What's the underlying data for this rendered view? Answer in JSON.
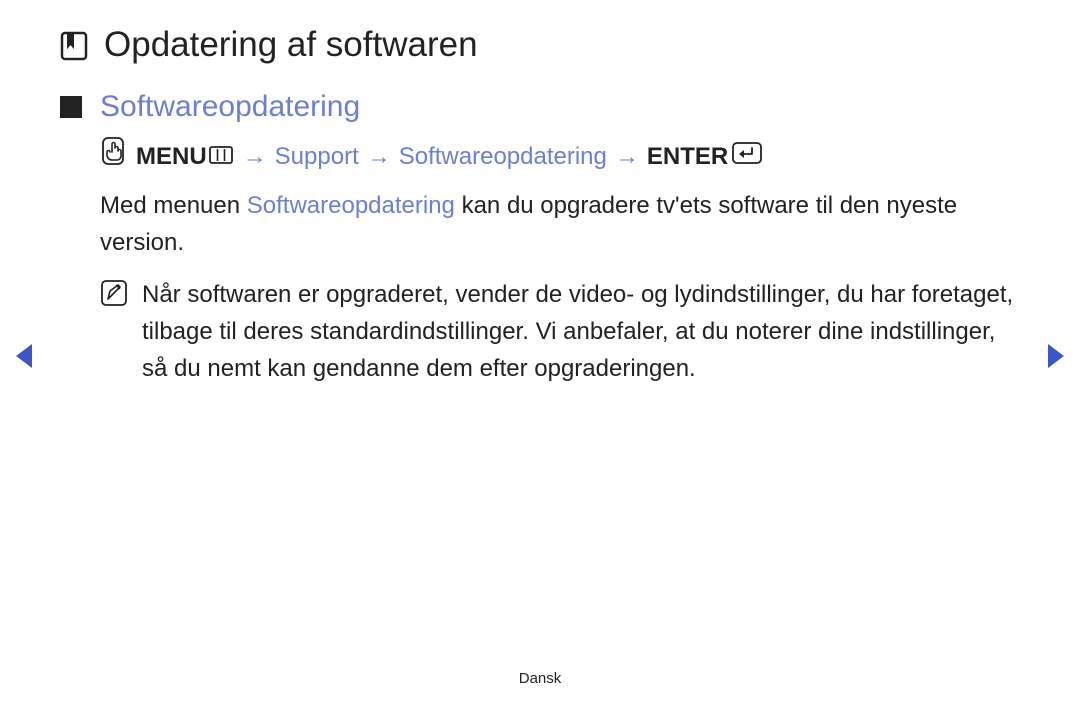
{
  "title": "Opdatering af softwaren",
  "section": "Softwareopdatering",
  "breadcrumb": {
    "menu_label": "MENU",
    "sep": "→",
    "step1": "Support",
    "step2": "Softwareopdatering",
    "enter_label": "ENTER"
  },
  "body": {
    "pre": "Med menuen ",
    "highlight": "Softwareopdatering",
    "post": " kan du opgradere tv'ets software til den nyeste version."
  },
  "note_text": "Når softwaren er opgraderet, vender de video- og lydindstillinger, du har foretaget, tilbage til deres standardindstillinger. Vi anbefaler, at du noterer dine indstillinger, så du nemt kan gendanne dem efter opgraderingen.",
  "footer_lang": "Dansk"
}
